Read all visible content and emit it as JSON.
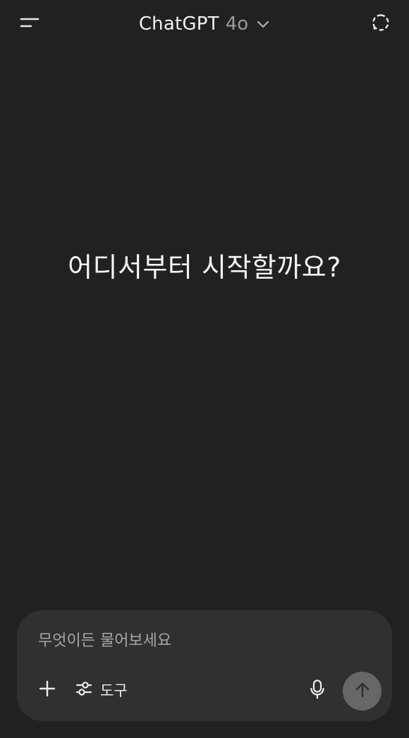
{
  "header": {
    "title": "ChatGPT",
    "model": "4o",
    "menu_icon": "menu-icon",
    "chevron_icon": "chevron-down-icon",
    "new_chat_icon": "new-chat-icon"
  },
  "main": {
    "prompt_heading": "어디서부터 시작할까요?"
  },
  "composer": {
    "placeholder": "무엇이든 물어보세요",
    "value": "",
    "plus_icon": "plus-icon",
    "tools_icon": "sliders-icon",
    "tools_label": "도구",
    "mic_icon": "microphone-icon",
    "send_icon": "arrow-up-icon"
  },
  "colors": {
    "background": "#212121",
    "composer_bg": "#303030",
    "send_button_bg": "#676767",
    "text": "#ececec",
    "muted_text": "#9a9a9a"
  }
}
